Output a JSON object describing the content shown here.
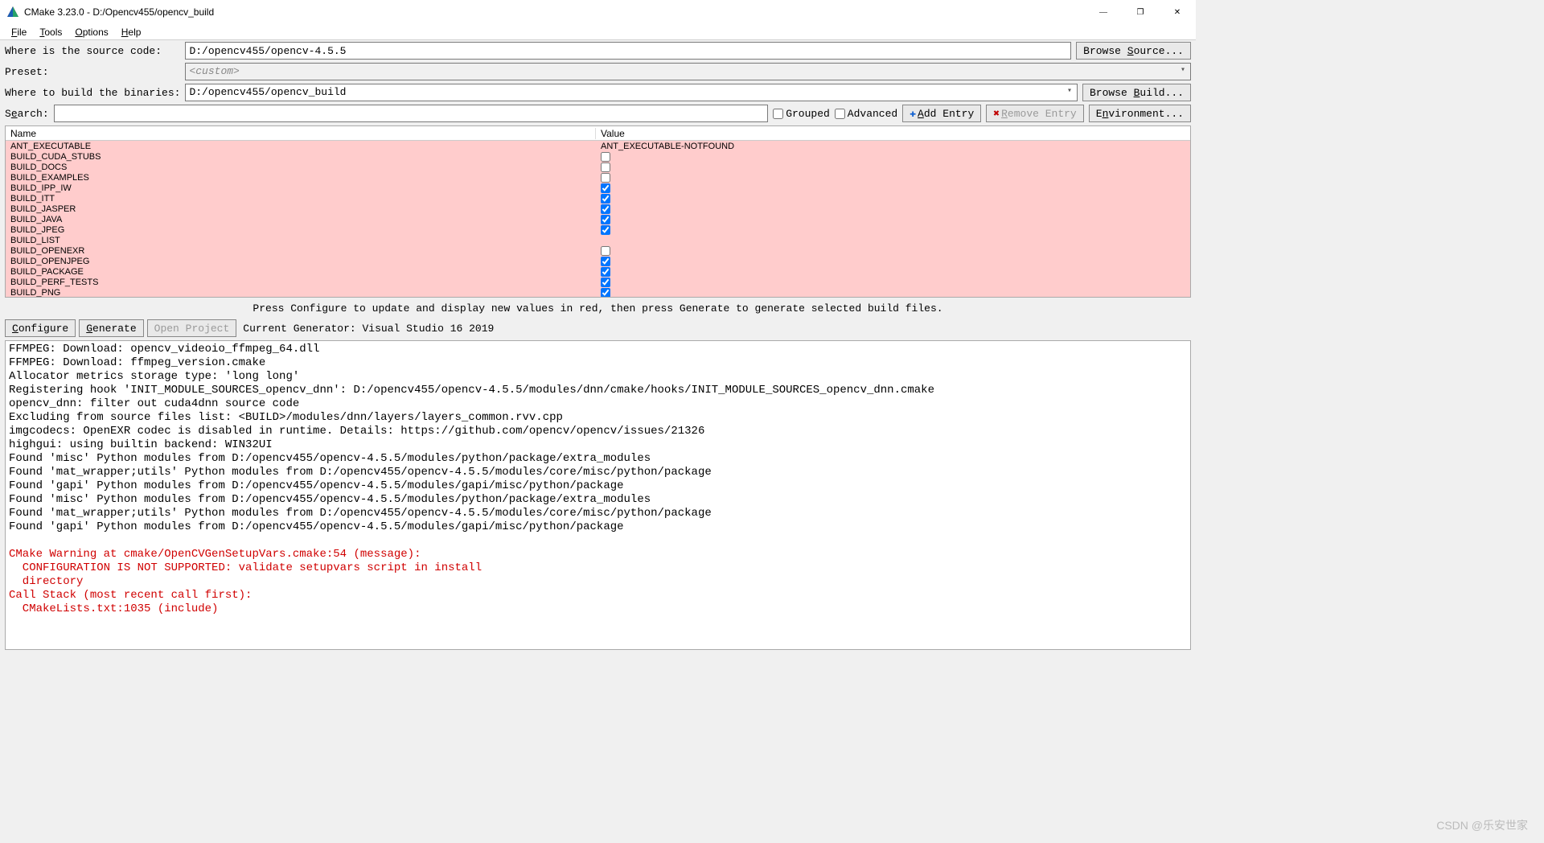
{
  "window": {
    "title": "CMake 3.23.0 - D:/Opencv455/opencv_build"
  },
  "menu": {
    "file": "File",
    "tools": "Tools",
    "options": "Options",
    "help": "Help"
  },
  "labels": {
    "src": "Where is the source code:   ",
    "preset": "Preset:                     ",
    "bin": "Where to build the binaries:",
    "search": "Search:",
    "browse_source": "Browse Source...",
    "browse_build": "Browse Build...",
    "grouped": "Grouped",
    "advanced": "Advanced",
    "add_entry": "Add Entry",
    "remove_entry": "Remove Entry",
    "environment": "Environment..."
  },
  "fields": {
    "src": "D:/opencv455/opencv-4.5.5",
    "preset": "<custom>",
    "bin": "D:/opencv455/opencv_build",
    "search": ""
  },
  "grid": {
    "name_hdr": "Name",
    "value_hdr": "Value",
    "rows": [
      {
        "n": "ANT_EXECUTABLE",
        "t": "text",
        "v": "ANT_EXECUTABLE-NOTFOUND",
        "red": true
      },
      {
        "n": "BUILD_CUDA_STUBS",
        "t": "cb",
        "v": false,
        "red": true
      },
      {
        "n": "BUILD_DOCS",
        "t": "cb",
        "v": false,
        "red": true
      },
      {
        "n": "BUILD_EXAMPLES",
        "t": "cb",
        "v": false,
        "red": true
      },
      {
        "n": "BUILD_IPP_IW",
        "t": "cb",
        "v": true,
        "red": true
      },
      {
        "n": "BUILD_ITT",
        "t": "cb",
        "v": true,
        "red": true
      },
      {
        "n": "BUILD_JASPER",
        "t": "cb",
        "v": true,
        "red": true
      },
      {
        "n": "BUILD_JAVA",
        "t": "cb",
        "v": true,
        "red": true
      },
      {
        "n": "BUILD_JPEG",
        "t": "cb",
        "v": true,
        "red": true
      },
      {
        "n": "BUILD_LIST",
        "t": "text",
        "v": "",
        "red": true
      },
      {
        "n": "BUILD_OPENEXR",
        "t": "cb",
        "v": false,
        "red": true
      },
      {
        "n": "BUILD_OPENJPEG",
        "t": "cb",
        "v": true,
        "red": true
      },
      {
        "n": "BUILD_PACKAGE",
        "t": "cb",
        "v": true,
        "red": true
      },
      {
        "n": "BUILD_PERF_TESTS",
        "t": "cb",
        "v": true,
        "red": true
      },
      {
        "n": "BUILD_PNG",
        "t": "cb",
        "v": true,
        "red": true
      }
    ]
  },
  "hint": "Press Configure to update and display new values in red, then press Generate to generate selected build files.",
  "actions": {
    "configure": "Configure",
    "generate": "Generate",
    "open_project": "Open Project",
    "gen_label": "Current Generator: Visual Studio 16 2019"
  },
  "log_black": "FFMPEG: Download: opencv_videoio_ffmpeg_64.dll\nFFMPEG: Download: ffmpeg_version.cmake\nAllocator metrics storage type: 'long long'\nRegistering hook 'INIT_MODULE_SOURCES_opencv_dnn': D:/opencv455/opencv-4.5.5/modules/dnn/cmake/hooks/INIT_MODULE_SOURCES_opencv_dnn.cmake\nopencv_dnn: filter out cuda4dnn source code\nExcluding from source files list: <BUILD>/modules/dnn/layers/layers_common.rvv.cpp\nimgcodecs: OpenEXR codec is disabled in runtime. Details: https://github.com/opencv/opencv/issues/21326\nhighgui: using builtin backend: WIN32UI\nFound 'misc' Python modules from D:/opencv455/opencv-4.5.5/modules/python/package/extra_modules\nFound 'mat_wrapper;utils' Python modules from D:/opencv455/opencv-4.5.5/modules/core/misc/python/package\nFound 'gapi' Python modules from D:/opencv455/opencv-4.5.5/modules/gapi/misc/python/package\nFound 'misc' Python modules from D:/opencv455/opencv-4.5.5/modules/python/package/extra_modules\nFound 'mat_wrapper;utils' Python modules from D:/opencv455/opencv-4.5.5/modules/core/misc/python/package\nFound 'gapi' Python modules from D:/opencv455/opencv-4.5.5/modules/gapi/misc/python/package",
  "log_red": "CMake Warning at cmake/OpenCVGenSetupVars.cmake:54 (message):\n  CONFIGURATION IS NOT SUPPORTED: validate setupvars script in install\n  directory\nCall Stack (most recent call first):\n  CMakeLists.txt:1035 (include)",
  "watermark": "CSDN @乐安世家"
}
